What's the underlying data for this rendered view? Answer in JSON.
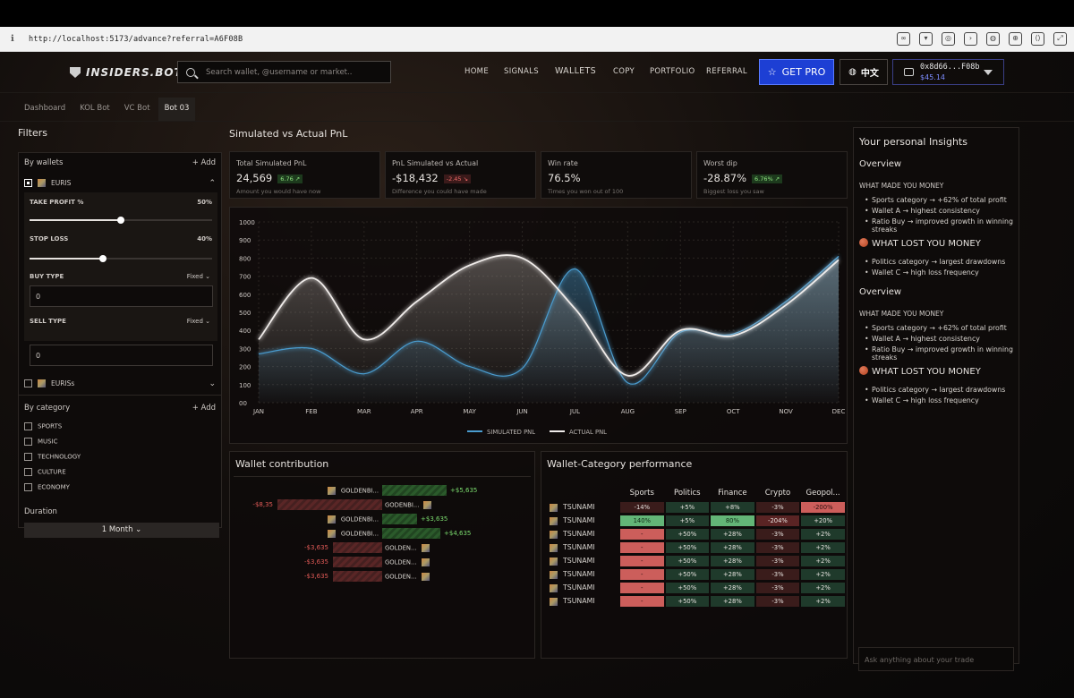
{
  "browser": {
    "url": "http://localhost:5173/advance?referral=A6F08B"
  },
  "nav": {
    "logo": "INSIDERS.BOT",
    "search_placeholder": "Search wallet, @username or market..",
    "menu": [
      "HOME",
      "SIGNALS",
      "WALLETS",
      "COPY",
      "PORTFOLIO",
      "REFERRAL"
    ],
    "get_pro": "GET PRO",
    "lang": "中文",
    "wallet_addr": "0x8d66...F08b",
    "wallet_bal": "$45.14"
  },
  "tabs": [
    "Dashboard",
    "KOL Bot",
    "VC Bot",
    "Bot 03"
  ],
  "filters": {
    "title": "Filters",
    "by_wallets": "By wallets",
    "add": "+ Add",
    "wallet1": "EURIS",
    "take_profit_label": "TAKE PROFIT %",
    "take_profit_val": "50%",
    "take_profit_frac": 0.5,
    "stop_loss_label": "STOP LOSS",
    "stop_loss_val": "40%",
    "stop_loss_frac": 0.4,
    "buy_type_label": "BUY TYPE",
    "buy_type": "Fixed",
    "buy_input": "0",
    "sell_type_label": "SELL TYPE",
    "sell_type": "Fixed",
    "sell_input": "0",
    "wallet2": "EURISs",
    "by_category": "By category",
    "categories": [
      "SPORTS",
      "MUSIC",
      "TECHNOLOGY",
      "CULTURE",
      "ECONOMY"
    ],
    "duration_label": "Duration",
    "duration": "1 Month"
  },
  "main": {
    "title": "Simulated vs Actual PnL",
    "kpis": [
      {
        "title": "Total Simulated PnL",
        "value": "24,569",
        "badge": "6.76 ↗",
        "badge_tone": "g",
        "value_tone": "",
        "desc": "Amount you would have now"
      },
      {
        "title": "PnL Simulated vs Actual",
        "value": "-$18,432",
        "badge": "-2.45 ↘",
        "badge_tone": "r",
        "value_tone": "red",
        "desc": "Difference you could have made"
      },
      {
        "title": "Win rate",
        "value": "76.5%",
        "badge": "",
        "badge_tone": "",
        "value_tone": "green",
        "desc": "Times you won out of 100"
      },
      {
        "title": "Worst dip",
        "value": "-28.87%",
        "badge": "6.76% ↗",
        "badge_tone": "g",
        "value_tone": "green",
        "desc": "Biggest loss you saw"
      }
    ]
  },
  "chart_data": {
    "type": "line",
    "x": [
      "JAN",
      "FEB",
      "MAR",
      "APR",
      "MAY",
      "JUN",
      "JUL",
      "AUG",
      "SEP",
      "OCT",
      "NOV",
      "DEC"
    ],
    "ylim": [
      0,
      1000
    ],
    "yticks": [
      "1000",
      "900",
      "800",
      "700",
      "600",
      "500",
      "400",
      "300",
      "200",
      "100",
      "00"
    ],
    "series": [
      {
        "name": "SIMULATED PNL",
        "color": "#4a9ccf",
        "values": [
          270,
          300,
          160,
          340,
          200,
          190,
          740,
          110,
          390,
          380,
          560,
          810
        ]
      },
      {
        "name": "ACTUAL PNL",
        "color": "#f0ecea",
        "values": [
          350,
          690,
          350,
          560,
          760,
          800,
          520,
          150,
          400,
          370,
          540,
          790
        ]
      }
    ]
  },
  "wallet_contribution": {
    "title": "Wallet contribution",
    "rows": [
      {
        "name": "GOLDENBI...",
        "value": "+$5,635",
        "dir": 1,
        "mag": 0.55
      },
      {
        "name": "GODENBI...",
        "value": "-$8,35",
        "dir": -1,
        "mag": 0.9
      },
      {
        "name": "GOLDENBI...",
        "value": "+$3,635",
        "dir": 1,
        "mag": 0.3
      },
      {
        "name": "GOLDENBI...",
        "value": "+$4,635",
        "dir": 1,
        "mag": 0.5
      },
      {
        "name": "GOLDEN...",
        "value": "-$3,635",
        "dir": -1,
        "mag": 0.42
      },
      {
        "name": "GOLDEN...",
        "value": "-$3,635",
        "dir": -1,
        "mag": 0.42
      },
      {
        "name": "GOLDEN...",
        "value": "-$3,635",
        "dir": -1,
        "mag": 0.42
      }
    ]
  },
  "category_perf": {
    "title": "Wallet-Category performance",
    "cols": [
      "Sports",
      "Politics",
      "Finance",
      "Crypto",
      "Geopol..."
    ],
    "rows": [
      {
        "name": "TSUNAMI",
        "cells": [
          [
            "-14%",
            "dr"
          ],
          [
            "+5%",
            "dg"
          ],
          [
            "+8%",
            "dg"
          ],
          [
            "-3%",
            "dr"
          ],
          [
            "-200%",
            "r"
          ]
        ]
      },
      {
        "name": "TSUNAMI",
        "cells": [
          [
            "140%",
            "g"
          ],
          [
            "+5%",
            "dg"
          ],
          [
            "80%",
            "g"
          ],
          [
            "-204%",
            "mr"
          ],
          [
            "+20%",
            "dg"
          ]
        ]
      },
      {
        "name": "TSUNAMI",
        "cells": [
          [
            "-",
            "r"
          ],
          [
            "+50%",
            "dg"
          ],
          [
            "+28%",
            "dg"
          ],
          [
            "-3%",
            "dr"
          ],
          [
            "+2%",
            "dg"
          ]
        ]
      },
      {
        "name": "TSUNAMI",
        "cells": [
          [
            "-",
            "r"
          ],
          [
            "+50%",
            "dg"
          ],
          [
            "+28%",
            "dg"
          ],
          [
            "-3%",
            "dr"
          ],
          [
            "+2%",
            "dg"
          ]
        ]
      },
      {
        "name": "TSUNAMI",
        "cells": [
          [
            "-",
            "r"
          ],
          [
            "+50%",
            "dg"
          ],
          [
            "+28%",
            "dg"
          ],
          [
            "-3%",
            "dr"
          ],
          [
            "+2%",
            "dg"
          ]
        ]
      },
      {
        "name": "TSUNAMI",
        "cells": [
          [
            "-",
            "r"
          ],
          [
            "+50%",
            "dg"
          ],
          [
            "+28%",
            "dg"
          ],
          [
            "-3%",
            "dr"
          ],
          [
            "+2%",
            "dg"
          ]
        ]
      },
      {
        "name": "TSUNAMI",
        "cells": [
          [
            "-",
            "r"
          ],
          [
            "+50%",
            "dg"
          ],
          [
            "+28%",
            "dg"
          ],
          [
            "-3%",
            "dr"
          ],
          [
            "+2%",
            "dg"
          ]
        ]
      },
      {
        "name": "TSUNAMI",
        "cells": [
          [
            "-",
            "r"
          ],
          [
            "+50%",
            "dg"
          ],
          [
            "+28%",
            "dg"
          ],
          [
            "-3%",
            "dr"
          ],
          [
            "+2%",
            "dg"
          ]
        ]
      }
    ]
  },
  "insights": {
    "title": "Your personal Insights",
    "overview": "Overview",
    "made": "WHAT MADE YOU MONEY",
    "made_items": [
      "Sports category → +62% of total profit",
      "Wallet A → highest consistency",
      "Ratio Buy → improved growth in winning streaks"
    ],
    "lost": "WHAT LOST YOU MONEY",
    "lost_items": [
      "Politics category → largest drawdowns",
      "Wallet C → high loss frequency"
    ],
    "ask_placeholder": "Ask anything about your trade"
  }
}
